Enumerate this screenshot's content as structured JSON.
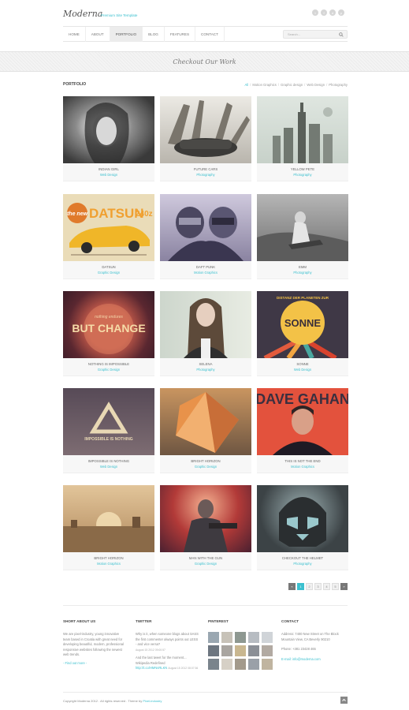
{
  "header": {
    "logo": "Moderna",
    "tagline": "Premium Site Template",
    "socials": [
      "twitter-icon",
      "facebook-icon",
      "dribbble-icon",
      "pinterest-icon"
    ]
  },
  "nav": {
    "items": [
      "HOME",
      "ABOUT",
      "PORTFOLIO",
      "BLOG",
      "FEATURES",
      "CONTACT"
    ],
    "active": "PORTFOLIO",
    "search_placeholder": "Search..."
  },
  "banner": {
    "title": "Checkout Our Work"
  },
  "portfolio": {
    "heading": "PORTFOLIO",
    "filters": [
      "All",
      "Motion Graphics",
      "Graphic design",
      "Web Design",
      "Photography"
    ],
    "items": [
      {
        "title": "INDIAN GIRL",
        "category": "Web Design"
      },
      {
        "title": "FUTURE CARS",
        "category": "Photography"
      },
      {
        "title": "YELLOW PETE",
        "category": "Photography"
      },
      {
        "title": "DATSUN",
        "category": "Graphic Design"
      },
      {
        "title": "DAFT PUNK",
        "category": "Motion Graphics"
      },
      {
        "title": "EMM",
        "category": "Photography"
      },
      {
        "title": "NOTHING IS IMPOSSIBLE",
        "category": "Graphic Design"
      },
      {
        "title": "SELENA",
        "category": "Photography"
      },
      {
        "title": "SONNE",
        "category": "Web Design"
      },
      {
        "title": "IMPOSSIBLE IS NOTHING",
        "category": "Web Design"
      },
      {
        "title": "BRIGHT HORIZON",
        "category": "Graphic Design"
      },
      {
        "title": "THIS IS NOT THE END",
        "category": "Motion Graphics"
      },
      {
        "title": "BRIGHT HORIZON",
        "category": "Motion Graphics"
      },
      {
        "title": "MAN WITH THE GUN",
        "category": "Graphic Design"
      },
      {
        "title": "CHECKOUT THE HELMET",
        "category": "Photography"
      }
    ],
    "thumb_text": {
      "datsun": "DATSUN",
      "datsun_badge": "the new",
      "datsun_num": "240z",
      "but_change": "BUT CHANGE",
      "nothing": "nothing endures",
      "sonne_top": "DISTANZ DER PLANETEN ZUR",
      "sonne": "SONNE",
      "impossible": "IMPOSSIBLE IS NOTHING",
      "dave": "DAVE GAHAN"
    }
  },
  "pagination": {
    "prev": "«",
    "pages": [
      "1",
      "2",
      "3",
      "4",
      "5"
    ],
    "active": "1",
    "next": "»"
  },
  "footer": {
    "about": {
      "title": "SHORT ABOUT US",
      "text": "We are pixel-industry, young innovative team based in Croatia with great need for developing beautiful, modern, professional responsive websites following the newest web trends.",
      "link": "- Find out more -"
    },
    "twitter": {
      "title": "TWITTER",
      "t1": "Why is it, when someone blogs about SASS the first commenter always points out LESS - and vice versa?",
      "t1_time": "August 15 2012 09:00:57",
      "t2": "And the last tweet for the moment... Wikipedia Redefined",
      "t2_link": "http://t.co/HMNsRLKN",
      "t2_time": "August 15 2012 08:07:36"
    },
    "pinterest": {
      "title": "PINTEREST"
    },
    "contact": {
      "title": "CONTACT",
      "address": "Address: 7400 New Street on The Block Mountain View, CA Beverly 90210",
      "phone": "Phone: +381 23428 465",
      "email": "E-mail: info@moderna.com"
    },
    "copyright": "Copyright Moderna 2012 . All rights reserved . Theme by",
    "copyright_link": "Pixel-industry"
  }
}
